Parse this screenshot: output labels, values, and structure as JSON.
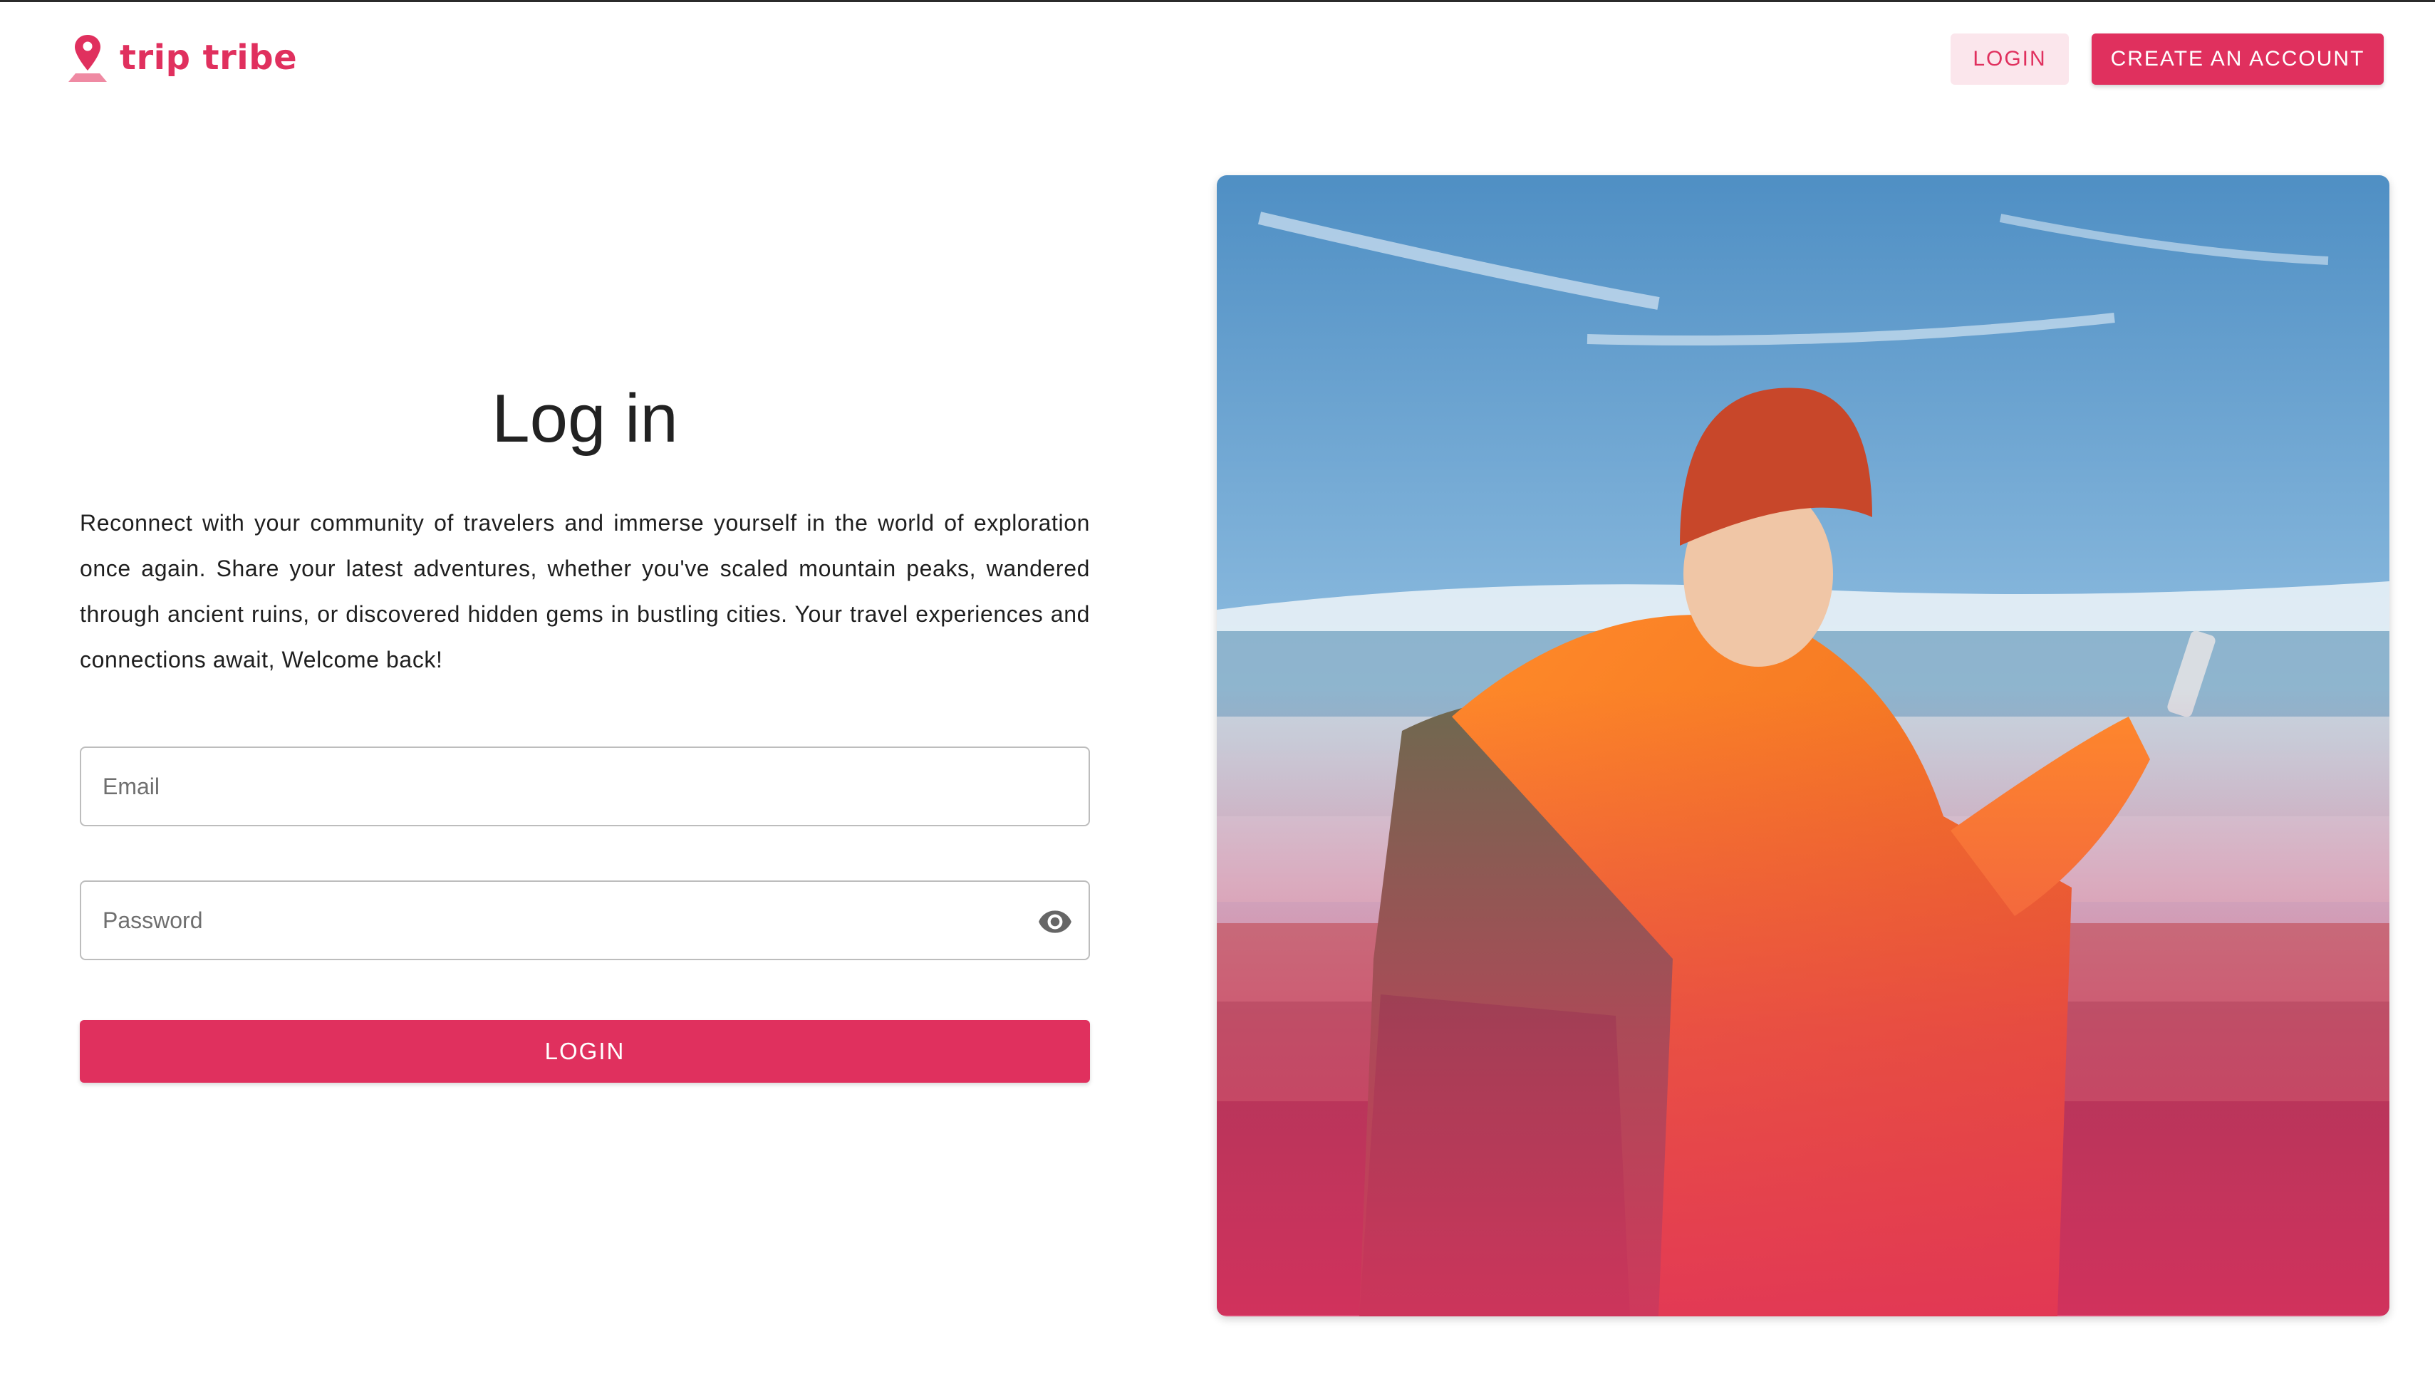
{
  "brand": {
    "name": "trip tribe",
    "logo_icon": "map-pin-icon",
    "color": "#e0305e"
  },
  "nav": {
    "login_label": "LOGIN",
    "create_account_label": "CREATE AN ACCOUNT"
  },
  "form": {
    "title": "Log in",
    "description": "Reconnect with your community of travelers and immerse yourself in the world of exploration once again. Share your latest adventures, whether you've scaled mountain peaks, wandered through ancient ruins, or discovered hidden gems in bustling cities. Your travel experiences and connections await, Welcome back!",
    "email": {
      "placeholder": "Email",
      "value": ""
    },
    "password": {
      "placeholder": "Password",
      "value": "",
      "toggle_icon": "eye-icon"
    },
    "submit_label": "LOGIN"
  },
  "hero": {
    "image": "traveler-with-backpack-photo"
  },
  "colors": {
    "accent": "#e0305e",
    "accent_light": "#fbe6ec",
    "text": "#1f1f1f"
  }
}
